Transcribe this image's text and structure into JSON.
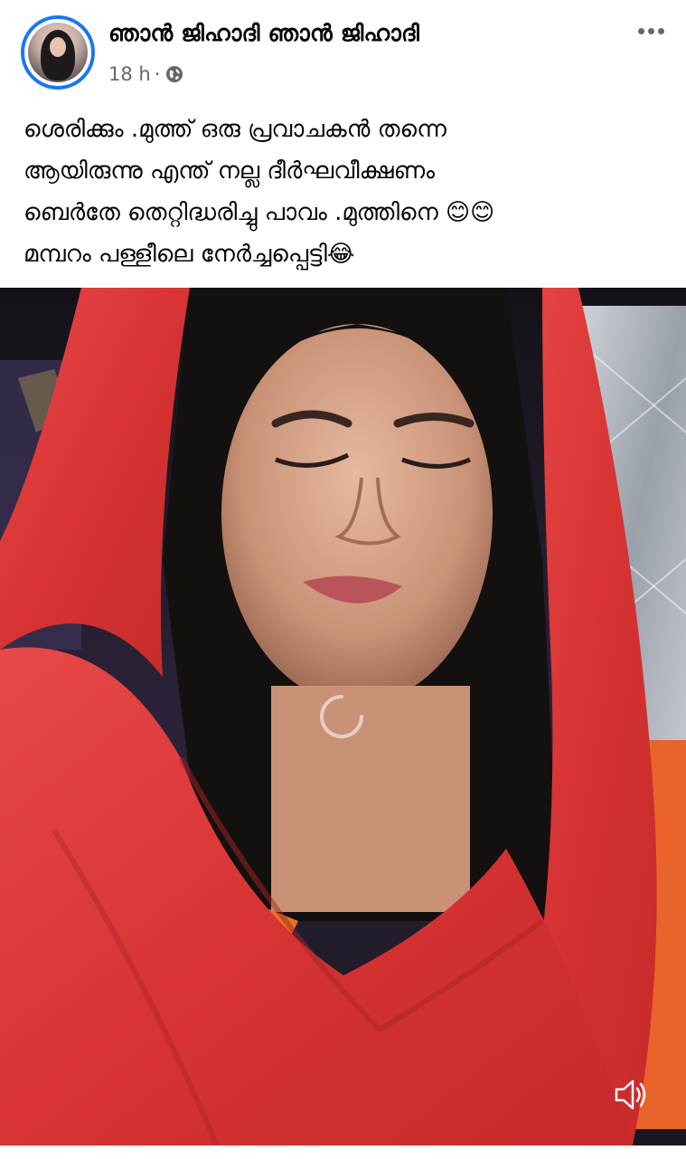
{
  "post": {
    "author": "ഞാൻ ജിഹാദി ഞാൻ ജിഹാദി",
    "time": "18 h",
    "separator": "·",
    "privacy_icon": "globe-icon",
    "more_icon": "more-options-icon",
    "text": "ശെരിക്കും .മുത്ത് ഒരു പ്രവാചകൻ തന്നെ\nആയിരുന്നു എന്ത് നല്ല ദീർഘവീക്ഷണം\nബെർതേ തെറ്റിദ്ധരിച്ചു പാവം .മുത്തിനെ 😊😊\nമമ്പറം പള്ളീലെ നേർച്ചപ്പെട്ടി😂"
  },
  "video": {
    "state": "loading",
    "loading_icon": "loading-spinner-icon",
    "volume_icon": "speaker-icon"
  },
  "colors": {
    "accent": "#1877f2",
    "secondary_text": "#65676b",
    "scarf": "#e23a3a"
  }
}
